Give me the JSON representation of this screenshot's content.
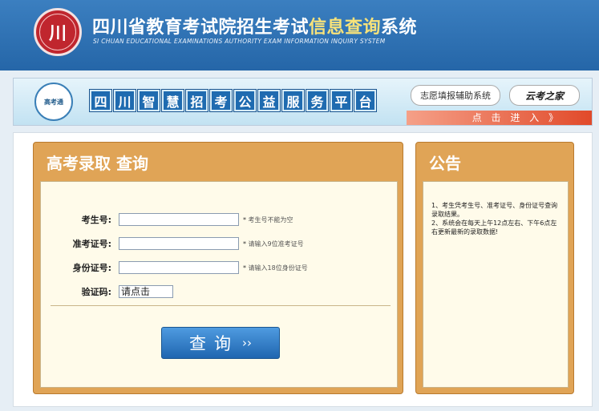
{
  "header": {
    "logo_text": "川",
    "title_main": "四川省教育考试院招生考试",
    "title_highlight": "信息查询",
    "title_end": "系统",
    "subtitle": "SI CHUAN EDUCATIONAL EXAMINATIONS AUTHORITY EXAM INFORMATION INQUIRY SYSTEM"
  },
  "banner": {
    "logo_text": "高考通",
    "platform_chars": [
      "四",
      "川",
      "智",
      "慧",
      "招",
      "考",
      "公",
      "益",
      "服",
      "务",
      "平",
      "台"
    ],
    "zhiyuan_button": "志愿填报辅助系统",
    "brand_button": "云考之家",
    "enter_link": "点 击 进 入 》"
  },
  "query_panel": {
    "title": "高考录取 查询",
    "fields": [
      {
        "label": "考生号:",
        "hint": "考生号不能为空"
      },
      {
        "label": "准考证号:",
        "hint": "请输入9位准考证号"
      },
      {
        "label": "身份证号:",
        "hint": "请输入18位身份证号"
      }
    ],
    "captcha_label": "验证码:",
    "captcha_value": "请点击",
    "submit_label": "查询",
    "submit_arrow": "››"
  },
  "notice_panel": {
    "title": "公告",
    "items": [
      "1、考生凭考生号、准考证号、身份证号查询录取结果。",
      "2、系统会在每天上午12点左右、下午6点左右更新最新的录取数据!"
    ]
  }
}
